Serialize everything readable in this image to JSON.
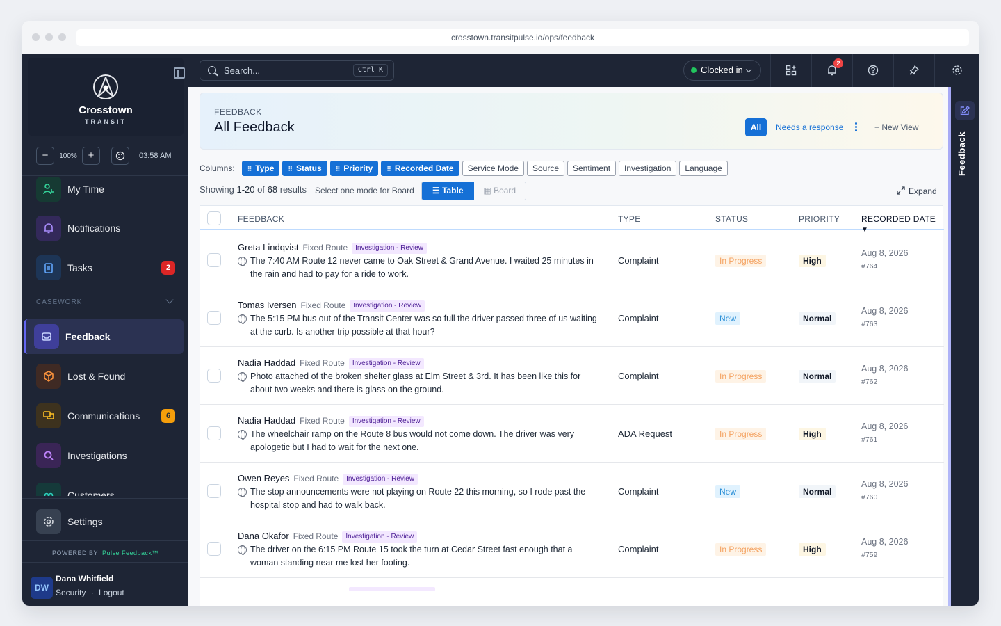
{
  "browser": {
    "url": "crosstown.transitpulse.io/ops/feedback"
  },
  "brand": {
    "name": "Crosstown",
    "sub": "TRANSIT"
  },
  "zoom": {
    "minus": "−",
    "level": "100%",
    "plus": "+",
    "time": "03:58 AM"
  },
  "nav": {
    "top_items": [
      {
        "label": "My Time"
      },
      {
        "label": "Notifications"
      },
      {
        "label": "Tasks",
        "badge": "2"
      }
    ],
    "section_label": "CASEWORK",
    "casework_items": [
      {
        "label": "Feedback"
      },
      {
        "label": "Lost & Found"
      },
      {
        "label": "Communications",
        "badge": "6"
      },
      {
        "label": "Investigations"
      },
      {
        "label": "Customers"
      }
    ],
    "settings": "Settings"
  },
  "powered_by": {
    "prefix": "POWERED BY",
    "product": "Pulse Feedback™"
  },
  "user": {
    "initials": "DW",
    "name": "Dana Whitfield",
    "link_security": "Security",
    "sep": "·",
    "link_logout": "Logout"
  },
  "topbar": {
    "search_placeholder": "Search...",
    "shortcut": "Ctrl K",
    "clock_status": "Clocked in",
    "notification_count": "2"
  },
  "header": {
    "kicker": "FEEDBACK",
    "title": "All Feedback",
    "views": {
      "all": "All",
      "needs_response": "Needs a response",
      "new_view": "+ New View"
    }
  },
  "columns_bar": {
    "label": "Columns:",
    "chips": [
      {
        "label": "Type",
        "on": true
      },
      {
        "label": "Status",
        "on": true
      },
      {
        "label": "Priority",
        "on": true
      },
      {
        "label": "Recorded Date",
        "on": true
      },
      {
        "label": "Service Mode",
        "on": false
      },
      {
        "label": "Source",
        "on": false
      },
      {
        "label": "Sentiment",
        "on": false
      },
      {
        "label": "Investigation",
        "on": false
      },
      {
        "label": "Language",
        "on": false
      }
    ]
  },
  "results": {
    "prefix": "Showing",
    "range": "1-20",
    "of": "of",
    "total": "68",
    "suffix": "results",
    "mode_hint": "Select one mode for Board",
    "mode_table": "Table",
    "mode_board": "Board",
    "expand": "Expand"
  },
  "table": {
    "headers": {
      "feedback": "FEEDBACK",
      "type": "TYPE",
      "status": "STATUS",
      "priority": "PRIORITY",
      "date": "RECORDED DATE"
    },
    "rows": [
      {
        "name": "Greta Lindqvist",
        "route": "Fixed Route",
        "tag": "Investigation - Review",
        "text": "The 7:40 AM Route 12 never came to Oak Street & Grand Avenue. I waited 25 minutes in the rain and had to pay for a ride to work.",
        "type": "Complaint",
        "status": "In Progress",
        "priority": "High",
        "date": "Aug 8, 2026",
        "id": "#764"
      },
      {
        "name": "Tomas Iversen",
        "route": "Fixed Route",
        "tag": "Investigation - Review",
        "text": "The 5:15 PM bus out of the Transit Center was so full the driver passed three of us waiting at the curb. Is another trip possible at that hour?",
        "type": "Complaint",
        "status": "New",
        "priority": "Normal",
        "date": "Aug 8, 2026",
        "id": "#763"
      },
      {
        "name": "Nadia Haddad",
        "route": "Fixed Route",
        "tag": "Investigation - Review",
        "text": "Photo attached of the broken shelter glass at Elm Street & 3rd. It has been like this for about two weeks and there is glass on the ground.",
        "type": "Complaint",
        "status": "In Progress",
        "priority": "Normal",
        "date": "Aug 8, 2026",
        "id": "#762"
      },
      {
        "name": "Nadia Haddad",
        "route": "Fixed Route",
        "tag": "Investigation - Review",
        "text": "The wheelchair ramp on the Route 8 bus would not come down. The driver was very apologetic but I had to wait for the next one.",
        "type": "ADA Request",
        "status": "In Progress",
        "priority": "High",
        "date": "Aug 8, 2026",
        "id": "#761"
      },
      {
        "name": "Owen Reyes",
        "route": "Fixed Route",
        "tag": "Investigation - Review",
        "text": "The stop announcements were not playing on Route 22 this morning, so I rode past the hospital stop and had to walk back.",
        "type": "Complaint",
        "status": "New",
        "priority": "Normal",
        "date": "Aug 8, 2026",
        "id": "#760"
      },
      {
        "name": "Dana Okafor",
        "route": "Fixed Route",
        "tag": "Investigation - Review",
        "text": "The driver on the 6:15 PM Route 15 took the turn at Cedar Street fast enough that a woman standing near me lost her footing.",
        "type": "Complaint",
        "status": "In Progress",
        "priority": "High",
        "date": "Aug 8, 2026",
        "id": "#759"
      }
    ]
  },
  "rail": {
    "label": "Feedback"
  },
  "colors": {
    "accent": "#1570d6",
    "sidebar": "#1e2535",
    "danger": "#ef4444",
    "warning": "#f59e0b",
    "success": "#22c55e"
  }
}
